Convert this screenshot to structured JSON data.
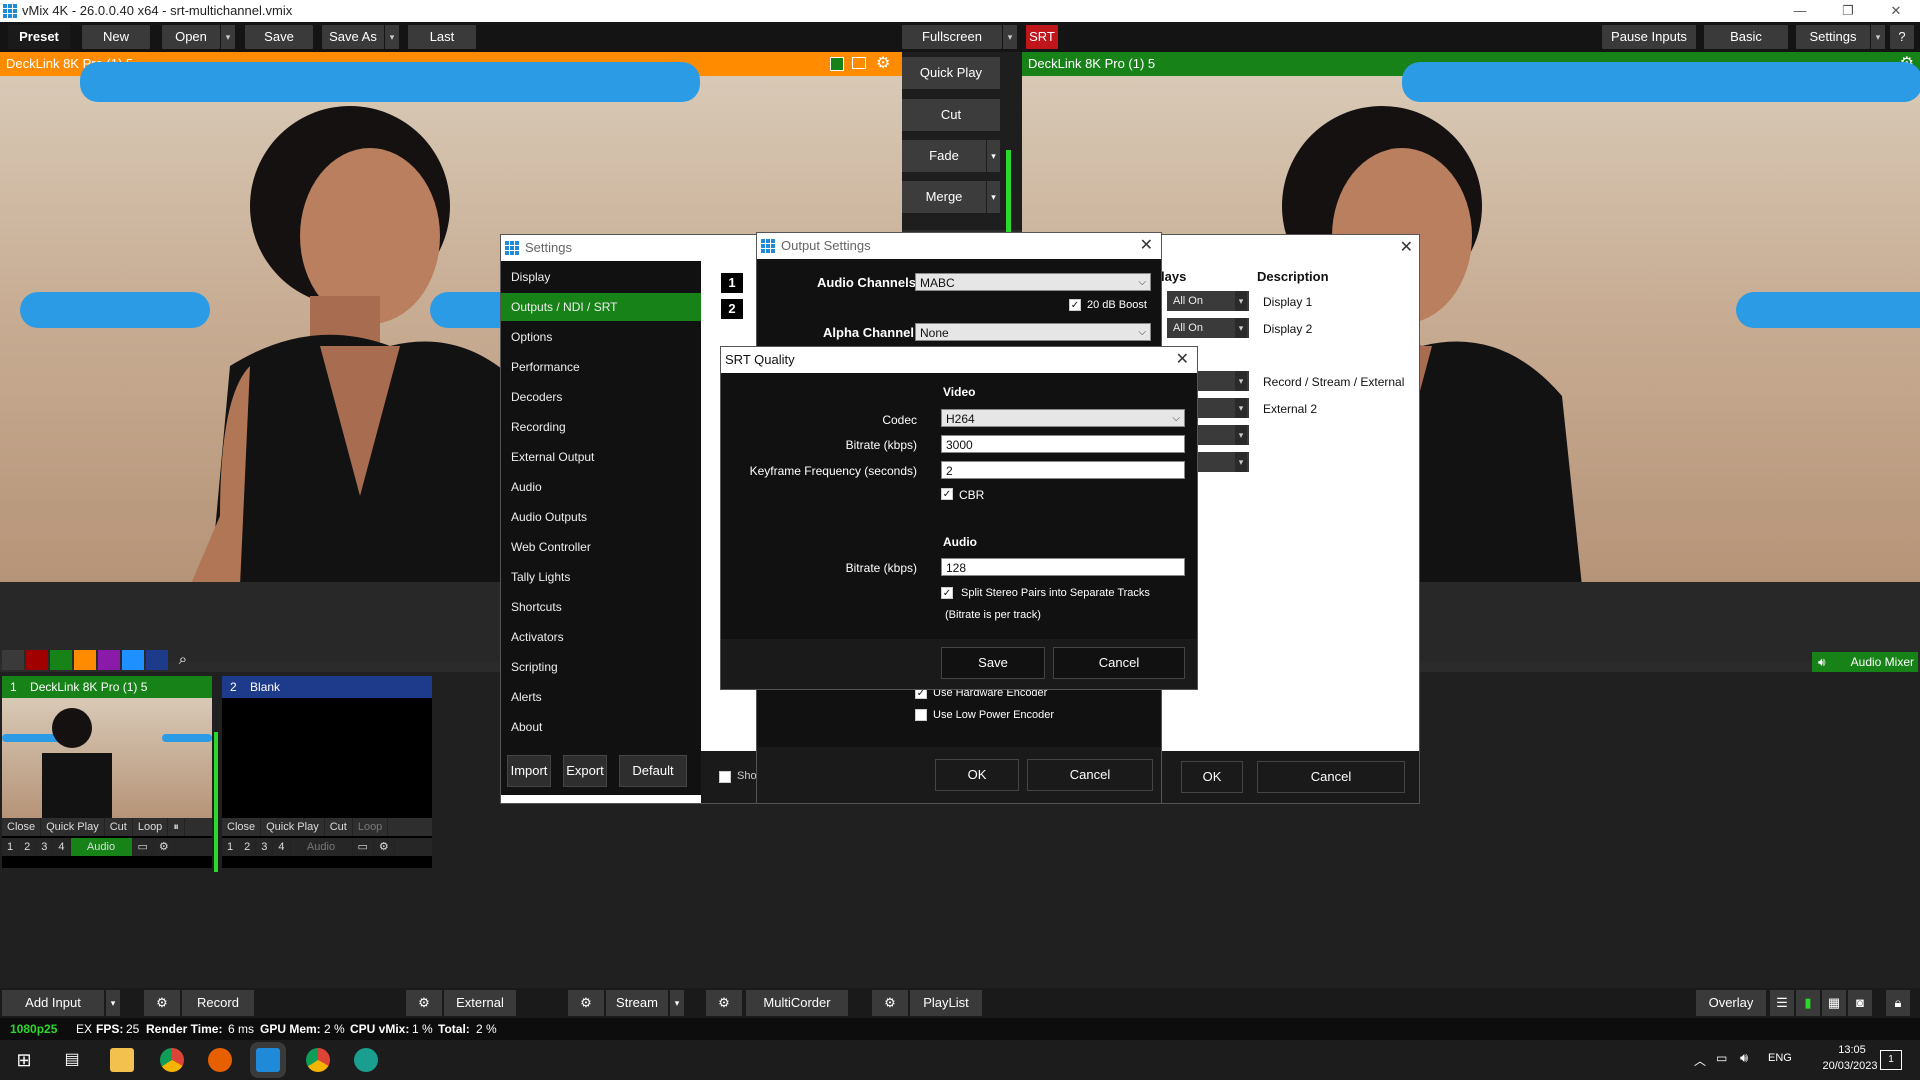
{
  "window": {
    "title": "vMix 4K - 26.0.0.40 x64 - srt-multichannel.vmix",
    "min": "—",
    "restore": "❐",
    "close": "✕"
  },
  "toolbar": {
    "preset": "Preset",
    "new": "New",
    "open": "Open",
    "save": "Save",
    "save_as": "Save As",
    "last": "Last",
    "fullscreen": "Fullscreen",
    "srt": "SRT",
    "pause_inputs": "Pause Inputs",
    "basic": "Basic",
    "settings": "Settings",
    "help": "?"
  },
  "preview": {
    "title": "DeckLink 8K Pro (1) 5"
  },
  "program": {
    "title": "DeckLink 8K Pro (1) 5"
  },
  "transitions": {
    "quick_play": "Quick Play",
    "cut": "Cut",
    "fade": "Fade",
    "merge": "Merge"
  },
  "colors": {
    "orange": "#ff8c00",
    "green": "#178217",
    "srt_red": "#c0151a",
    "blue": "#1e3a8a"
  },
  "inputs": [
    {
      "num": "1",
      "name": "DeckLink 8K Pro (1) 5",
      "buttons": [
        "Close",
        "Quick Play",
        "Cut",
        "Loop",
        "⏸"
      ],
      "nums": [
        "1",
        "2",
        "3",
        "4"
      ],
      "audio": "Audio"
    },
    {
      "num": "2",
      "name": "Blank",
      "buttons": [
        "Close",
        "Quick Play",
        "Cut",
        "Loop"
      ],
      "nums": [
        "1",
        "2",
        "3",
        "4"
      ],
      "audio": "Audio"
    }
  ],
  "audio_mixer": "Audio Mixer",
  "settings_dialog": {
    "title": "Settings",
    "menu": [
      "Display",
      "Outputs / NDI / SRT",
      "Options",
      "Performance",
      "Decoders",
      "Recording",
      "External Output",
      "Audio",
      "Audio Outputs",
      "Web Controller",
      "Tally Lights",
      "Shortcuts",
      "Activators",
      "Scripting",
      "Alerts",
      "About"
    ],
    "import": "Import",
    "export": "Export",
    "default": "Default",
    "ok": "OK",
    "cancel": "Cancel",
    "show_label": "Sho",
    "col_displays": "lays",
    "col_description": "Description",
    "rows": [
      {
        "num": "1",
        "mode": "All On",
        "desc": "Display 1"
      },
      {
        "num": "2",
        "mode": "All On",
        "desc": "Display 2"
      }
    ],
    "desc_more": [
      "Record / Stream / External",
      "External 2"
    ]
  },
  "output_dialog": {
    "title": "Output Settings",
    "audio_channels_label": "Audio Channels",
    "audio_channels_value": "MABC",
    "boost_label": "20 dB Boost",
    "alpha_label": "Alpha Channel",
    "alpha_value": "None",
    "hw_encoder": "Use Hardware Encoder",
    "low_power": "Use Low Power Encoder",
    "ok": "OK",
    "cancel": "Cancel"
  },
  "srt_dialog": {
    "title": "SRT Quality",
    "video_heading": "Video",
    "codec_label": "Codec",
    "codec_value": "H264",
    "bitrate_label": "Bitrate (kbps)",
    "bitrate_value": "3000",
    "keyframe_label": "Keyframe Frequency (seconds)",
    "keyframe_value": "2",
    "cbr_label": "CBR",
    "audio_heading": "Audio",
    "audio_bitrate_label": "Bitrate (kbps)",
    "audio_bitrate_value": "128",
    "split_label": "Split Stereo Pairs into Separate Tracks",
    "per_track": "(Bitrate is per track)",
    "save": "Save",
    "cancel": "Cancel"
  },
  "bottom": {
    "add_input": "Add Input",
    "record": "Record",
    "external": "External",
    "stream": "Stream",
    "multicorder": "MultiCorder",
    "playlist": "PlayList",
    "overlay": "Overlay"
  },
  "status": {
    "format": "1080p25",
    "ex": "EX",
    "fps_label": "FPS:",
    "fps": "25",
    "render_label": "Render Time:",
    "render": "6 ms",
    "gpu_label": "GPU Mem:",
    "gpu": "2 %",
    "cpu_label": "CPU vMix:",
    "cpu": "1 %",
    "total_label": "Total:",
    "total": "2 %"
  },
  "taskbar": {
    "time": "13:05",
    "date": "20/03/2023",
    "lang": "ENG",
    "notif": "1"
  }
}
